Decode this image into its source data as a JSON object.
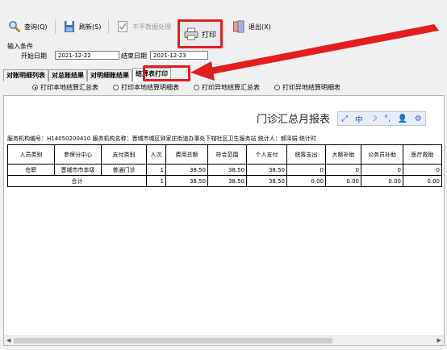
{
  "toolbar": {
    "query": "查询(Q)",
    "refresh": "刷新(S)",
    "abnormal": "不平数据处理",
    "print": "打印",
    "exit": "退出(X)"
  },
  "filter": {
    "group_title": "输入条件",
    "start_label": "开始日期",
    "start_value": "2021-12-22",
    "end_label": "结束日期",
    "end_value": "2021-12-23"
  },
  "tabs": [
    "对账明细列表",
    "对总账结果",
    "对明细账结果",
    "结算表打印"
  ],
  "radios": [
    {
      "label": "打印本地结算汇总表",
      "checked": true
    },
    {
      "label": "打印本地结算明细表",
      "checked": false
    },
    {
      "label": "打印异地结算汇总表",
      "checked": false
    },
    {
      "label": "打印异地结算明细表",
      "checked": false
    }
  ],
  "report": {
    "title": "门诊汇总月报表",
    "info": "服务机构编号：H14050200410   服务机构名称：晋城市城区钟家庄街道办事处下辖社区卫生服务站           统计人：郝泽娟                   统计时",
    "headers": [
      "人员类别",
      "参保分中心",
      "支付类别",
      "人次",
      "费用总额",
      "符合范围",
      "个人支付",
      "统筹支出",
      "大额补助",
      "公务员补助",
      "医疗救助"
    ],
    "rows": [
      [
        "在职",
        "晋城市市本级",
        "普通门诊",
        "1",
        "38.50",
        "38.50",
        "38.50",
        "0",
        "0",
        "0",
        "0"
      ]
    ],
    "total": {
      "label": "合计",
      "values": [
        "1",
        "38.50",
        "38.50",
        "38.50",
        "0.00",
        "0.00",
        "0.00",
        "0.00"
      ]
    }
  },
  "colors": {
    "highlight": "#e41e1e"
  }
}
